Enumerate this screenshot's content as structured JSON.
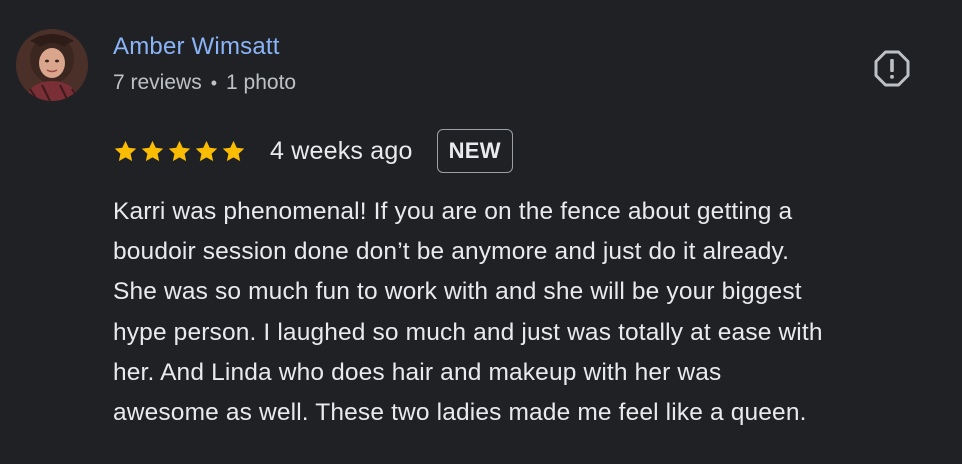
{
  "review": {
    "author_name": "Amber Wimsatt",
    "reviews_count": "7 reviews",
    "separator": "•",
    "photos_count": "1 photo",
    "rating": 5,
    "rating_max": 5,
    "star_color": "#fbbc04",
    "time_ago": "4 weeks ago",
    "badge": "NEW",
    "text_lines": [
      "Karri was phenomenal! If you are on the fence about getting a",
      "boudoir session done don’t be anymore and just do it already.",
      "She was so much fun to work with and she will be your biggest",
      "hype person. I laughed so much and just was totally at ease with",
      "her. And Linda who does hair and makeup with her was",
      "awesome as well. These two ladies made me feel like a queen."
    ]
  },
  "icons": {
    "avatar": "profile-photo",
    "report": "report-flag-octagon-icon",
    "star": "star-icon"
  },
  "colors": {
    "background": "#202124",
    "author_link": "#8ab4f8",
    "text_primary": "#e8eaed",
    "text_secondary": "#bdc1c6"
  }
}
